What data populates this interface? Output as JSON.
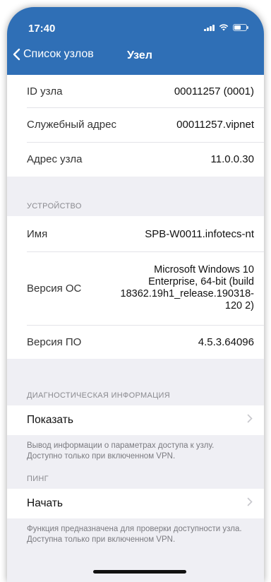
{
  "status_bar": {
    "time": "17:40"
  },
  "nav": {
    "back_label": "Список узлов",
    "title": "Узел"
  },
  "node_info": [
    {
      "label": "ID узла",
      "value": "00011257 (0001)"
    },
    {
      "label": "Служебный адрес",
      "value": "00011257.vipnet"
    },
    {
      "label": "Адрес узла",
      "value": "11.0.0.30"
    }
  ],
  "device": {
    "header": "УСТРОЙСТВО",
    "rows": [
      {
        "label": "Имя",
        "value": "SPB-W0011.infotecs-nt"
      },
      {
        "label": "Версия ОС",
        "value": "Microsoft Windows 10 Enterprise, 64-bit (build 18362.19h1_release.190318-120 2)"
      },
      {
        "label": "Версия ПО",
        "value": "4.5.3.64096"
      }
    ]
  },
  "diagnostics": {
    "header": "ДИАГНОСТИЧЕСКАЯ ИНФОРМАЦИЯ",
    "action_label": "Показать",
    "note": "Вывод информации о параметрах доступа к узлу. Доступно только при включенном VPN."
  },
  "ping": {
    "header": "ПИНГ",
    "action_label": "Начать",
    "note": "Функция предназначена для проверки доступности узла. Доступна только при включенном VPN."
  },
  "colors": {
    "header_bg": "#2f6fb6",
    "page_bg": "#efeff4"
  },
  "icons": {
    "back": "chevron-left-icon",
    "chevron": "chevron-right-icon"
  }
}
